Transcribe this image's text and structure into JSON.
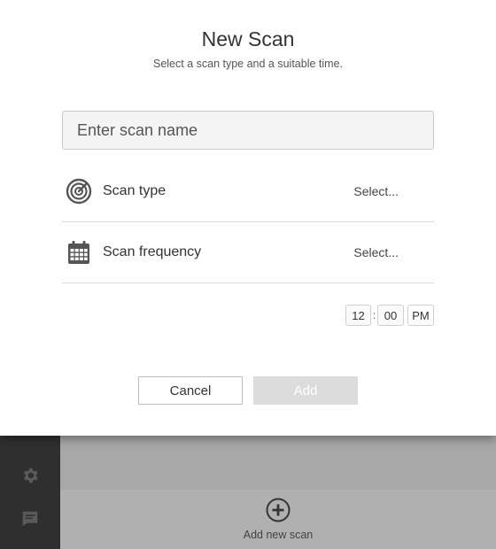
{
  "modal": {
    "title": "New Scan",
    "subtitle": "Select a scan type and a suitable time.",
    "name_input": {
      "placeholder": "Enter scan name",
      "value": ""
    },
    "rows": [
      {
        "icon": "radar-icon",
        "label": "Scan type",
        "value": "Select..."
      },
      {
        "icon": "calendar-icon",
        "label": "Scan frequency",
        "value": "Select..."
      }
    ],
    "time": {
      "hour": "12",
      "separator": ":",
      "minute": "00",
      "ampm": "PM"
    },
    "buttons": {
      "cancel": "Cancel",
      "add": "Add"
    }
  },
  "background": {
    "sidebar_icons": [
      "gear-icon",
      "chat-icon"
    ],
    "add_scan": {
      "icon": "plus-circle-icon",
      "label": "Add new scan"
    }
  },
  "colors": {
    "modal_bg": "#ffffff",
    "add_button_disabled": "#dcdcdc",
    "sidebar_bg": "#2f2f2f",
    "overlay_bg": "#a9a9a9"
  }
}
